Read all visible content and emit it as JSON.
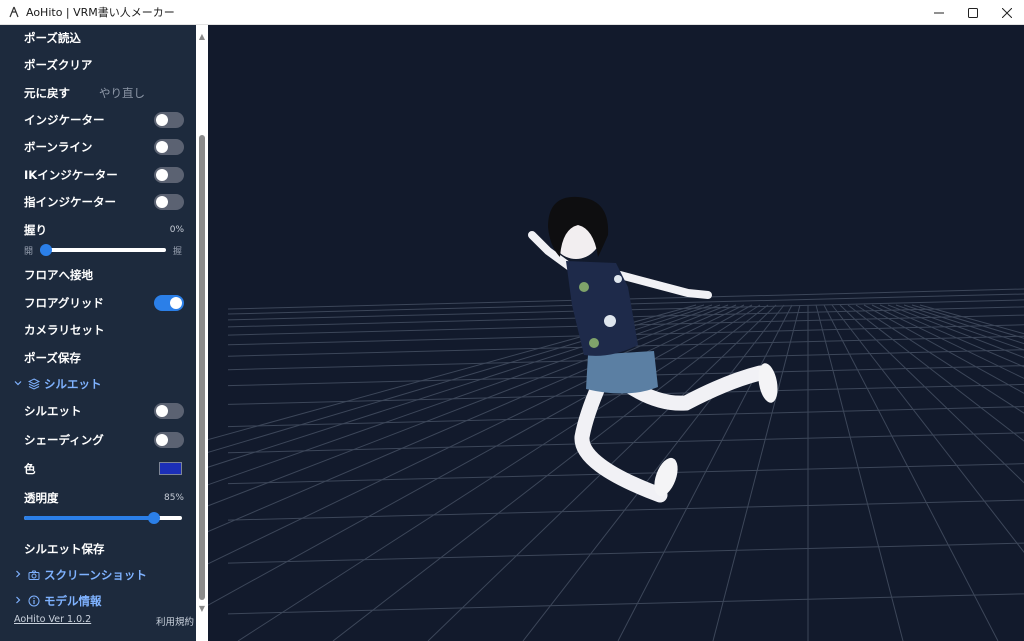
{
  "window": {
    "title": "AoHito | VRM書い人メーカー",
    "controls": [
      "minimize-icon",
      "maximize-icon",
      "close-icon"
    ]
  },
  "sidebar": {
    "pose_load": "ポーズ読込",
    "pose_clear": "ポーズクリア",
    "undo": "元に戻す",
    "redo": "やり直し",
    "indicator": {
      "label": "インジケーター",
      "on": false
    },
    "bone_line": {
      "label": "ボーンライン",
      "on": false
    },
    "ik_indicator": {
      "label": "IKインジケーター",
      "on": false
    },
    "finger_indicator": {
      "label": "指インジケーター",
      "on": false
    },
    "grip": {
      "label": "握り",
      "value": "0%",
      "min_label": "開",
      "max_label": "握",
      "level": 0
    },
    "floor_snap": "フロアへ接地",
    "floor_grid": {
      "label": "フロアグリッド",
      "on": true
    },
    "camera_reset": "カメラリセット",
    "pose_save": "ポーズ保存",
    "silhouette_section": "シルエット",
    "silhouette": {
      "label": "シルエット",
      "on": false
    },
    "shading": {
      "label": "シェーディング",
      "on": false
    },
    "color": {
      "label": "色",
      "value": "#1c2fb8"
    },
    "opacity": {
      "label": "透明度",
      "value": "85%",
      "level": 0.85
    },
    "silhouette_save": "シルエット保存",
    "screenshot_section": "スクリーンショット",
    "model_info_section": "モデル情報",
    "version": "AoHito Ver 1.0.2",
    "terms": "利用規約"
  },
  "colors": {
    "sidebar_bg": "#1d2a3d",
    "viewport_bg": "#121a2c",
    "accent": "#2b7fe8",
    "section_text": "#7fb2ff"
  }
}
